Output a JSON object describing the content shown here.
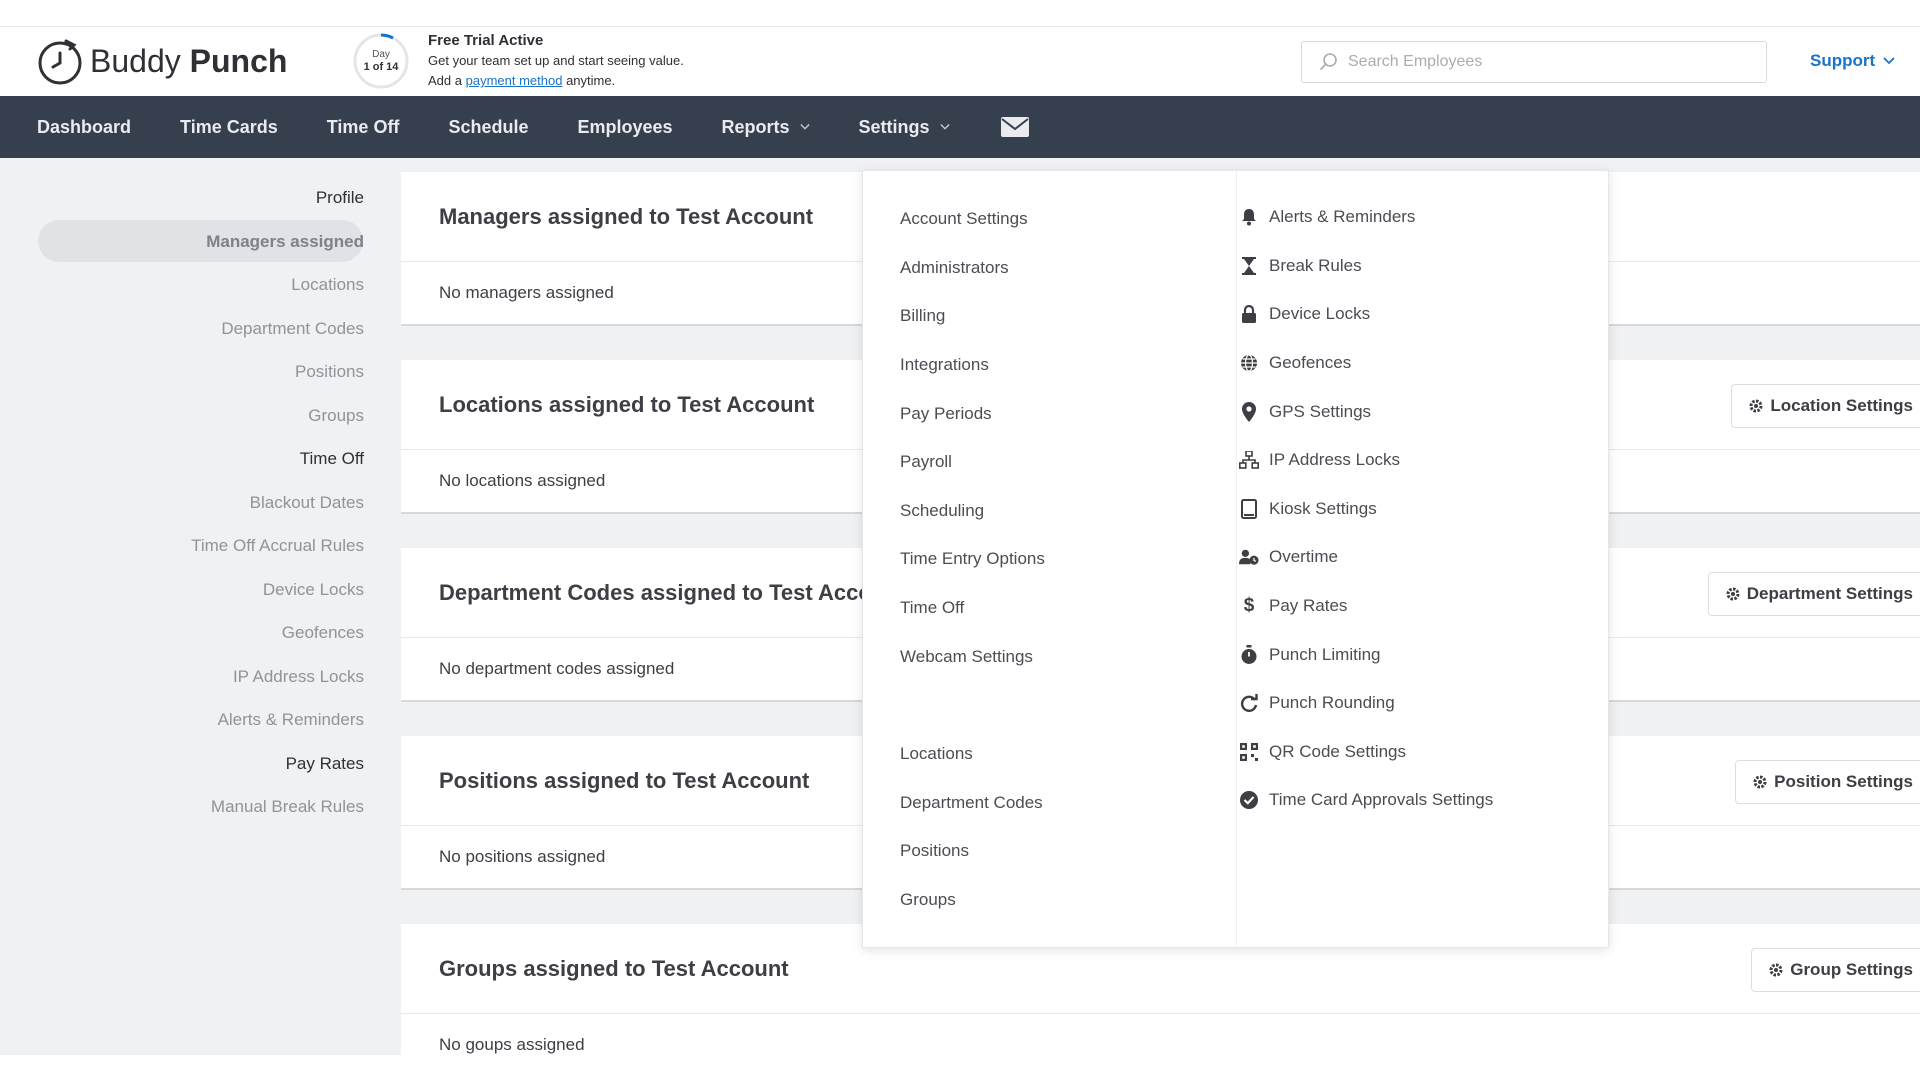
{
  "brand": {
    "name_light": "Buddy",
    "name_bold": "Punch"
  },
  "trial": {
    "day_label": "Day",
    "day_count": "1 of 14",
    "title": "Free Trial Active",
    "line1": "Get your team set up and start seeing value.",
    "line2_pre": "Add a",
    "line2_link": "payment method",
    "line2_post": "anytime."
  },
  "search": {
    "placeholder": "Search Employees"
  },
  "support": {
    "label": "Support"
  },
  "nav": {
    "items": [
      {
        "label": "Dashboard"
      },
      {
        "label": "Time Cards"
      },
      {
        "label": "Time Off"
      },
      {
        "label": "Schedule"
      },
      {
        "label": "Employees"
      },
      {
        "label": "Reports"
      },
      {
        "label": "Settings"
      }
    ]
  },
  "sidebar": {
    "items": [
      {
        "label": "Profile"
      },
      {
        "label": "Managers assigned"
      },
      {
        "label": "Locations"
      },
      {
        "label": "Department Codes"
      },
      {
        "label": "Positions"
      },
      {
        "label": "Groups"
      },
      {
        "label": "Time Off"
      },
      {
        "label": "Blackout Dates"
      },
      {
        "label": "Time Off Accrual Rules"
      },
      {
        "label": "Device Locks"
      },
      {
        "label": "Geofences"
      },
      {
        "label": "IP Address Locks"
      },
      {
        "label": "Alerts & Reminders"
      },
      {
        "label": "Pay Rates"
      },
      {
        "label": "Manual Break Rules"
      }
    ]
  },
  "cards": [
    {
      "title": "Managers assigned to Test Account",
      "body": "No managers assigned",
      "button": ""
    },
    {
      "title": "Locations assigned to Test Account",
      "body": "No locations assigned",
      "button": "Location Settings"
    },
    {
      "title": "Department Codes assigned to Test Account",
      "body": "No department codes assigned",
      "button": "Department Settings"
    },
    {
      "title": "Positions assigned to Test Account",
      "body": "No positions assigned",
      "button": "Position Settings"
    },
    {
      "title": "Groups assigned to Test Account",
      "body": "No goups assigned",
      "button": "Group Settings"
    }
  ],
  "settings_menu": {
    "left": [
      {
        "label": "Account Settings"
      },
      {
        "label": "Administrators"
      },
      {
        "label": "Billing"
      },
      {
        "label": "Integrations"
      },
      {
        "label": "Pay Periods"
      },
      {
        "label": "Payroll"
      },
      {
        "label": "Scheduling"
      },
      {
        "label": "Time Entry Options"
      },
      {
        "label": "Time Off"
      },
      {
        "label": "Webcam Settings"
      },
      {
        "label": "Locations"
      },
      {
        "label": "Department Codes"
      },
      {
        "label": "Positions"
      },
      {
        "label": "Groups"
      }
    ],
    "right": [
      {
        "label": "Alerts & Reminders",
        "icon": "bell-icon"
      },
      {
        "label": "Break Rules",
        "icon": "hourglass-icon"
      },
      {
        "label": "Device Locks",
        "icon": "lock-icon"
      },
      {
        "label": "Geofences",
        "icon": "globe-icon"
      },
      {
        "label": "GPS Settings",
        "icon": "map-pin-icon"
      },
      {
        "label": "IP Address Locks",
        "icon": "network-icon"
      },
      {
        "label": "Kiosk Settings",
        "icon": "tablet-icon"
      },
      {
        "label": "Overtime",
        "icon": "user-clock-icon"
      },
      {
        "label": "Pay Rates",
        "icon": "dollar-icon"
      },
      {
        "label": "Punch Limiting",
        "icon": "stopwatch-icon"
      },
      {
        "label": "Punch Rounding",
        "icon": "rotate-icon"
      },
      {
        "label": "QR Code Settings",
        "icon": "qrcode-icon"
      },
      {
        "label": "Time Card Approvals Settings",
        "icon": "check-circle-icon"
      }
    ]
  },
  "colors": {
    "nav_bg": "#363f4d",
    "link": "#1a73c8",
    "page_bg": "#f0f1f3"
  }
}
